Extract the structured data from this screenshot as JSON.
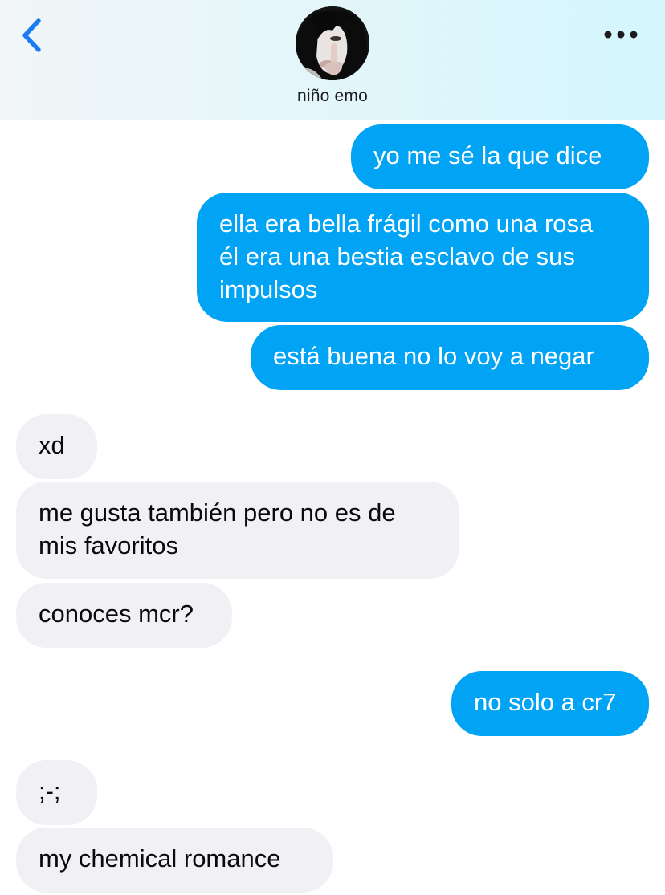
{
  "header": {
    "back_icon": "chevron-left-icon",
    "more_icon": "ellipsis-icon",
    "contact_name": "niño emo",
    "accent_color": "#1a7cf5"
  },
  "colors": {
    "outgoing_bubble": "#01a3f4",
    "incoming_bubble": "#f0f0f5"
  },
  "messages": [
    {
      "direction": "outgoing",
      "text": "yo me sé la que dice"
    },
    {
      "direction": "outgoing",
      "text": "ella era bella frágil como una rosa\nél era una bestia esclavo de sus\nimpulsos"
    },
    {
      "direction": "outgoing",
      "text": "está buena no lo voy a negar"
    },
    {
      "direction": "incoming",
      "text": "xd"
    },
    {
      "direction": "incoming",
      "text": "me gusta también pero no es de\nmis favoritos"
    },
    {
      "direction": "incoming",
      "text": "conoces mcr?"
    },
    {
      "direction": "outgoing",
      "text": "no solo a cr7"
    },
    {
      "direction": "incoming",
      "text": ";-;"
    },
    {
      "direction": "incoming",
      "text": "my chemical romance"
    }
  ]
}
